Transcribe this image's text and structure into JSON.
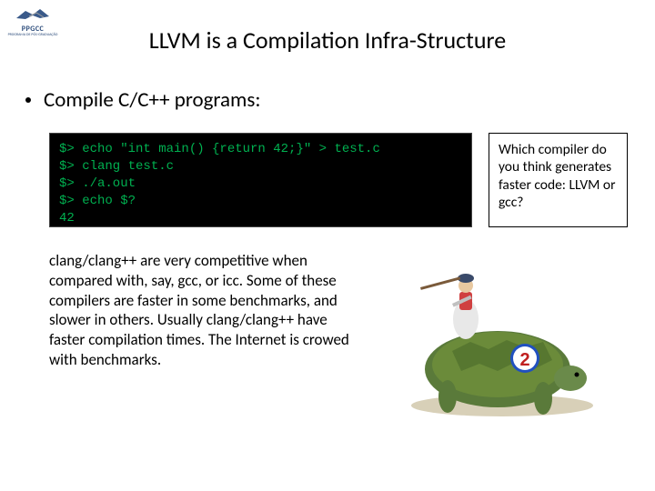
{
  "logo": {
    "text": "PPGCC",
    "sub": "PROGRAMA DE PÓS-GRADUAÇÃO"
  },
  "title": "LLVM is a Compilation Infra-Structure",
  "bullet": "Compile C/C++ programs:",
  "terminal": {
    "lines": [
      "$> echo \"int main() {return 42;}\" > test.c",
      "$> clang test.c",
      "$> ./a.out",
      "$> echo $?",
      "42"
    ]
  },
  "question": "Which compiler do you think generates faster code: LLVM or gcc?",
  "paragraph": "clang/clang++ are very competitive when compared with, say, gcc, or icc. Some of these compilers are faster in some benchmarks, and slower in others. Usually clang/clang++ have faster compilation times. The Internet is crowed with benchmarks.",
  "illustration": {
    "badge_number": "2"
  }
}
